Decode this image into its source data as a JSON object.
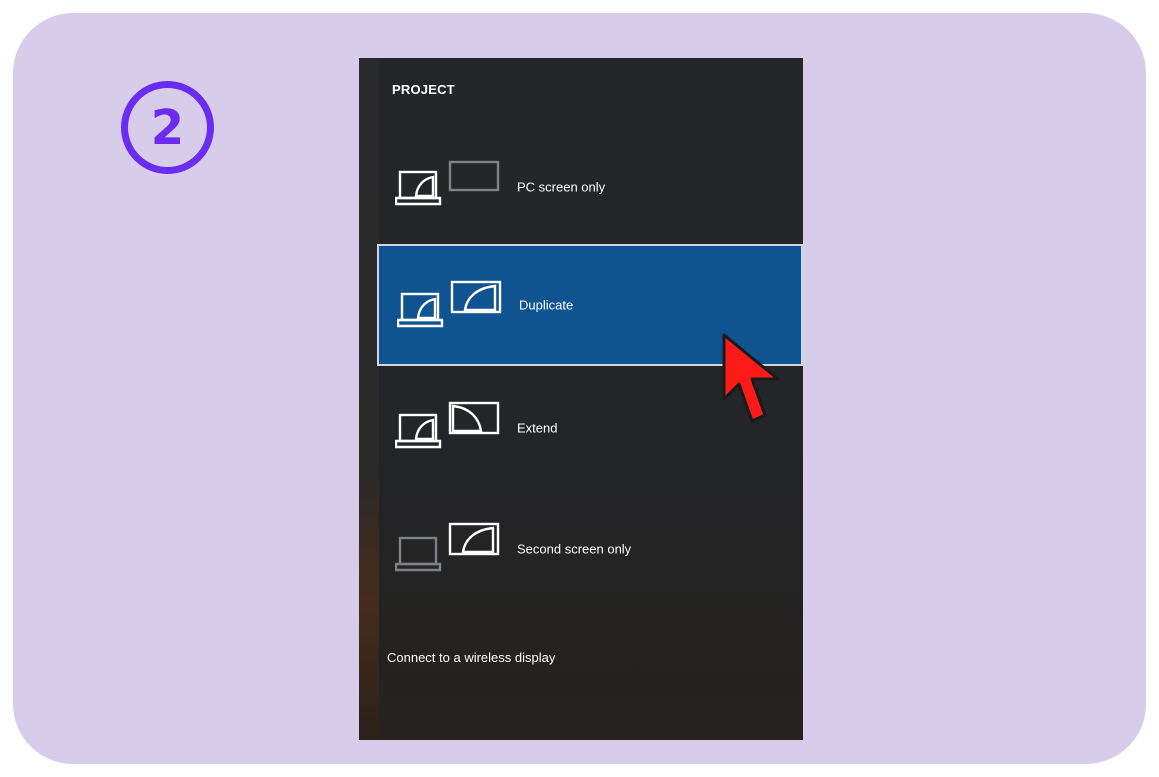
{
  "step": {
    "number": "2"
  },
  "panel": {
    "title": "PROJECT",
    "options": [
      {
        "label": "PC screen only",
        "selected": false
      },
      {
        "label": "Duplicate",
        "selected": true
      },
      {
        "label": "Extend",
        "selected": false
      },
      {
        "label": "Second screen only",
        "selected": false
      }
    ],
    "wireless_link": "Connect to a wireless display"
  },
  "colors": {
    "card_background": "#d7cdea",
    "step_accent": "#6a2cf0",
    "panel_background": "#242628",
    "selected_background": "#0f5490",
    "cursor": "#ff1a1a"
  },
  "icons": {
    "pc_screen_only": "laptop-with-empty-monitor-icon",
    "duplicate": "laptop-mirrored-monitor-icon",
    "extend": "laptop-extended-monitor-icon",
    "second_screen_only": "dimmed-laptop-active-monitor-icon",
    "pointer": "mouse-pointer-icon"
  }
}
